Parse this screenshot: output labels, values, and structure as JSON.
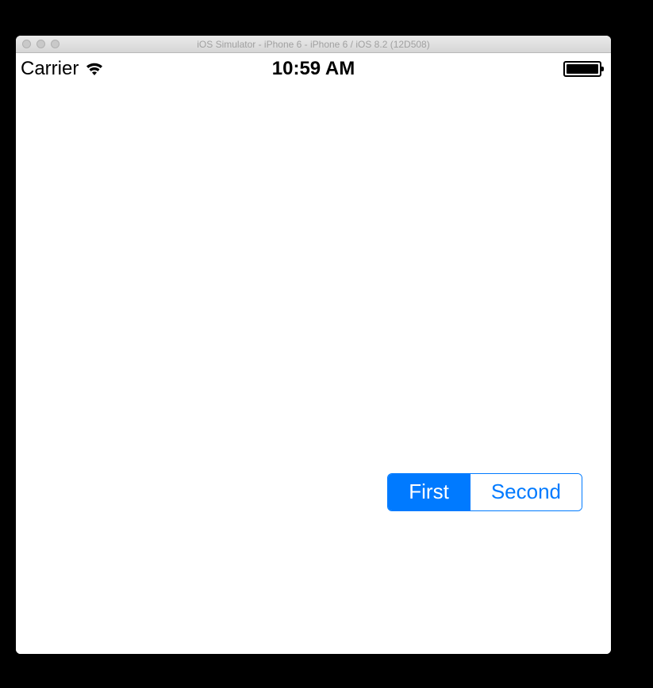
{
  "window": {
    "title": "iOS Simulator - iPhone 6 - iPhone 6 / iOS 8.2 (12D508)"
  },
  "statusBar": {
    "carrier": "Carrier",
    "time": "10:59 AM"
  },
  "segmentedControl": {
    "segments": [
      "First",
      "Second"
    ],
    "selectedIndex": 0
  },
  "colors": {
    "tint": "#007aff"
  }
}
